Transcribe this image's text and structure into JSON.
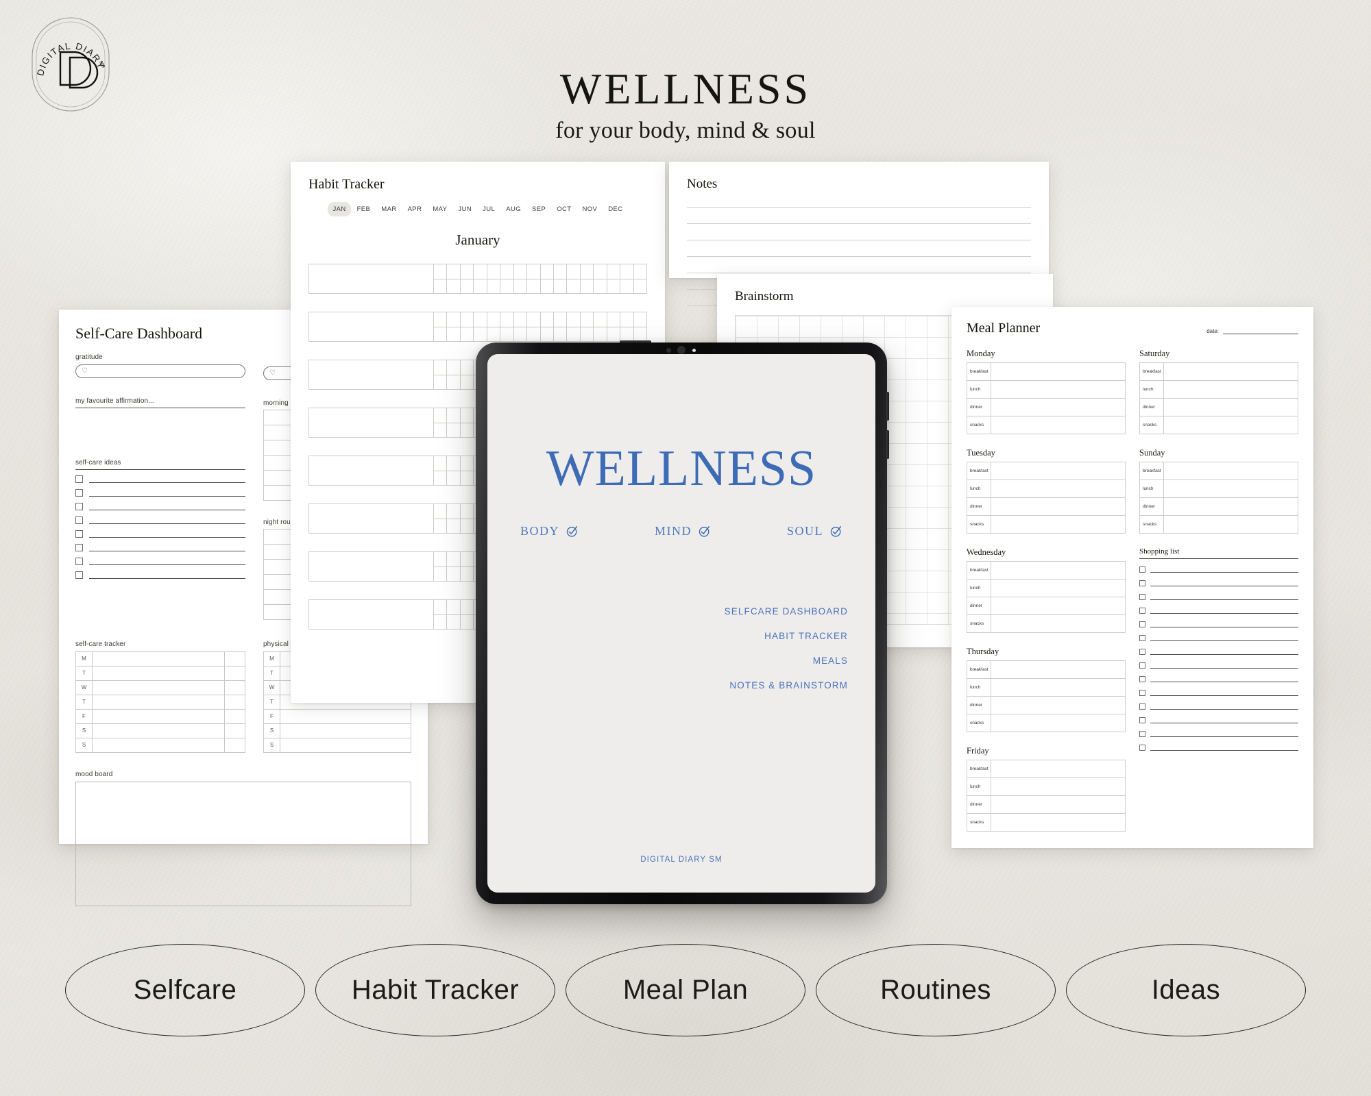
{
  "brand": {
    "logo_arc": "DIGITAL DIARY",
    "logo_sm": "sm",
    "logo_monogram": "DD"
  },
  "header": {
    "title": "WELLNESS",
    "subtitle": "for your body, mind & soul"
  },
  "colors": {
    "background": "#e9e8e2",
    "accent_blue": "#3d6bb5",
    "link_blue": "#4a72bb",
    "ink": "#16150f",
    "sheet": "#ffffff"
  },
  "tablet": {
    "screen_title": "WELLNESS",
    "pillars": [
      {
        "label": "BODY",
        "icon": "check-circle-icon"
      },
      {
        "label": "MIND",
        "icon": "check-circle-icon"
      },
      {
        "label": "SOUL",
        "icon": "check-circle-icon"
      }
    ],
    "menu": [
      "SELFCARE DASHBOARD",
      "HABIT TRACKER",
      "MEALS",
      "NOTES & BRAINSTORM"
    ],
    "footer": "DIGITAL DIARY SM"
  },
  "selfcare": {
    "title": "Self-Care Dashboard",
    "gratitude_label": "gratitude",
    "gratitude_icon": "heart-icon",
    "affirmation_label": "my favourite affirmation...",
    "ideas_label": "self-care ideas",
    "ideas_rows": 8,
    "morning_label": "morning routine",
    "night_label": "night routine",
    "routine_rows": 6,
    "tracker_label": "self-care tracker",
    "activity_label": "physical activity",
    "weekdays": [
      "M",
      "T",
      "W",
      "T",
      "F",
      "S",
      "S"
    ],
    "mood_label": "mood board"
  },
  "habit": {
    "title": "Habit Tracker",
    "months": [
      "JAN",
      "FEB",
      "MAR",
      "APR",
      "MAY",
      "JUN",
      "JUL",
      "AUG",
      "SEP",
      "OCT",
      "NOV",
      "DEC"
    ],
    "selected_month": "JAN",
    "month_heading": "January",
    "rows": 8,
    "day_columns": 16
  },
  "notes": {
    "title": "Notes",
    "lines": 7
  },
  "brainstorm": {
    "title": "Brainstorm"
  },
  "meal": {
    "title": "Meal Planner",
    "date_label": "date:",
    "meal_rows": [
      "breakfast",
      "lunch",
      "dinner",
      "snacks"
    ],
    "left_days": [
      "Monday",
      "Tuesday",
      "Wednesday",
      "Thursday",
      "Friday"
    ],
    "right_days": [
      "Saturday",
      "Sunday"
    ],
    "shopping_label": "Shopping list",
    "shopping_rows": 14
  },
  "ovals": [
    "Selfcare",
    "Habit Tracker",
    "Meal Plan",
    "Routines",
    "Ideas"
  ]
}
